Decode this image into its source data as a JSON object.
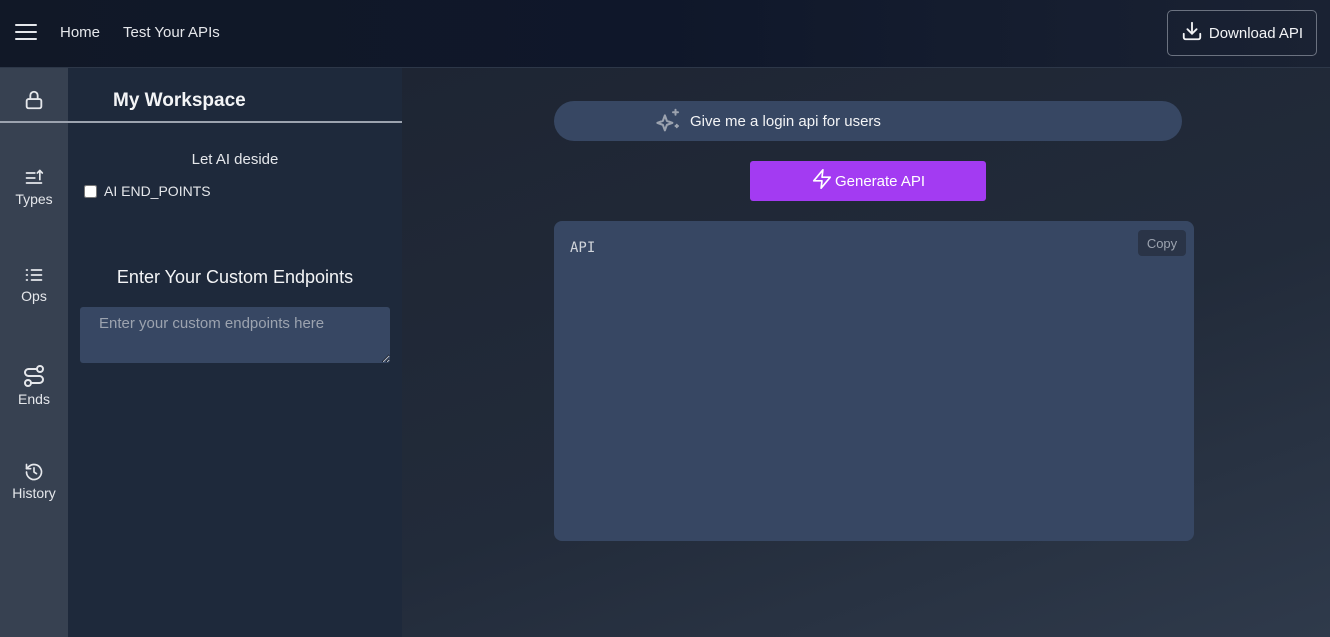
{
  "nav": {
    "home": "Home",
    "test_apis": "Test Your APIs",
    "download_label": "Download API"
  },
  "rail": {
    "types": "Types",
    "ops": "Ops",
    "ends": "Ends",
    "history": "History"
  },
  "workspace": {
    "title": "My Workspace",
    "ai_label": "Let AI deside",
    "ai_checkbox_label": "AI END_POINTS",
    "ai_checkbox_checked": false,
    "custom_heading": "Enter Your Custom Endpoints",
    "custom_placeholder": "Enter your custom endpoints here"
  },
  "main": {
    "prompt_value": "Give me a login api for users",
    "generate_label": "Generate API",
    "output_text": "API",
    "copy_label": "Copy"
  },
  "colors": {
    "accent": "#a33bf2",
    "input_bg": "#374763",
    "rail_bg": "#374151",
    "panel_bg": "#1e293b"
  }
}
